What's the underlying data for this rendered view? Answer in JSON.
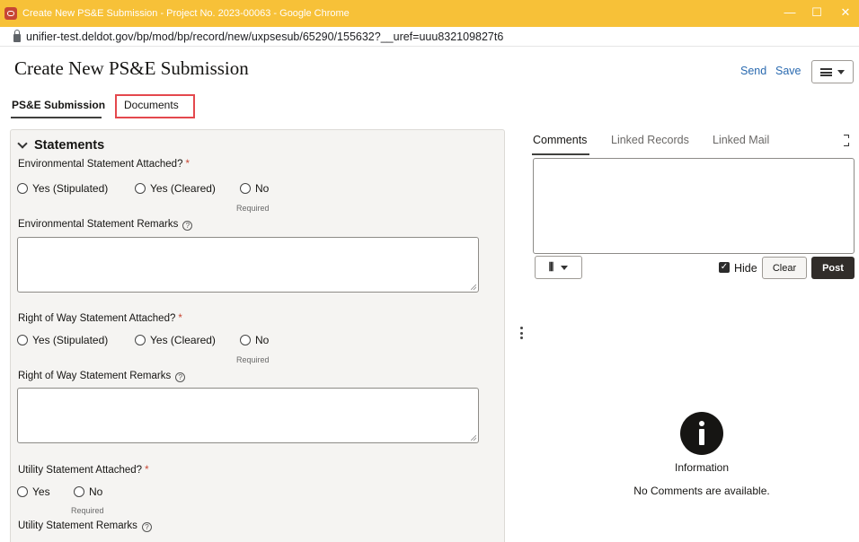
{
  "window": {
    "title": "Create New PS&E Submission - Project No. 2023-00063 - Google Chrome",
    "url": "unifier-test.deldot.gov/bp/mod/bp/record/new/uxpsesub/65290/155632?__uref=uuu832109827t6"
  },
  "header": {
    "title": "Create New PS&E Submission",
    "send_label": "Send",
    "save_label": "Save"
  },
  "tabs": {
    "ps_submission": "PS&E Submission",
    "documents": "Documents"
  },
  "form": {
    "section_title": "Statements",
    "required_hint": "Required",
    "environmental": {
      "label": "Environmental Statement Attached?",
      "options": [
        "Yes (Stipulated)",
        "Yes (Cleared)",
        "No"
      ],
      "remarks_label": "Environmental Statement Remarks",
      "remarks_value": ""
    },
    "right_of_way": {
      "label": "Right of Way Statement Attached?",
      "options": [
        "Yes (Stipulated)",
        "Yes (Cleared)",
        "No"
      ],
      "remarks_label": "Right of Way Statement Remarks",
      "remarks_value": ""
    },
    "utility": {
      "label": "Utility Statement Attached?",
      "options": [
        "Yes",
        "No"
      ],
      "remarks_label": "Utility Statement Remarks"
    },
    "required_star": "*",
    "help_glyph": "?"
  },
  "right_panel": {
    "tabs": [
      "Comments",
      "Linked Records",
      "Linked Mail"
    ],
    "comment_text": "",
    "hide_label": "Hide",
    "hide_checked": true,
    "clear_label": "Clear",
    "post_label": "Post",
    "info_title": "Information",
    "info_message": "No Comments are available."
  },
  "colors": {
    "titlebar": "#f7c138",
    "accent_link": "#2a6ab0",
    "highlight_box": "#e4484d",
    "post_button": "#312d2a"
  }
}
